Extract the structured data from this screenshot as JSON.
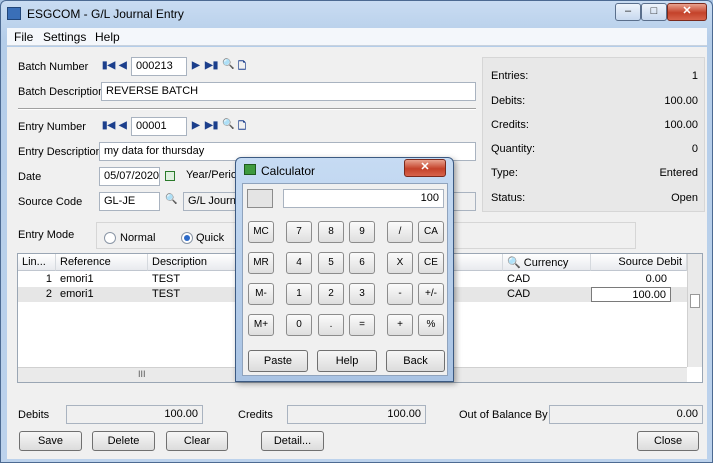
{
  "window": {
    "title": "ESGCOM - G/L Journal Entry",
    "controls": {
      "minimize": "–",
      "maximize": "□",
      "close": "✕"
    }
  },
  "menu": {
    "file": "File",
    "settings": "Settings",
    "help": "Help"
  },
  "form": {
    "batch_number_label": "Batch Number",
    "batch_number": "000213",
    "batch_description_label": "Batch Description",
    "batch_description": "REVERSE BATCH",
    "entry_number_label": "Entry Number",
    "entry_number": "00001",
    "entry_description_label": "Entry Description",
    "entry_description": "my data for thursday",
    "date_label": "Date",
    "date": "05/07/2020",
    "year_period_label": "Year/Period",
    "source_code_label": "Source Code",
    "source_code": "GL-JE",
    "source_code_desc": "G/L Journal",
    "entry_mode_label": "Entry Mode",
    "mode_normal": "Normal",
    "mode_quick": "Quick",
    "selected_mode": "Quick"
  },
  "summary": {
    "entries_label": "Entries:",
    "entries": "1",
    "debits_label": "Debits:",
    "debits": "100.00",
    "credits_label": "Credits:",
    "credits": "100.00",
    "quantity_label": "Quantity:",
    "quantity": "0",
    "type_label": "Type:",
    "type": "Entered",
    "status_label": "Status:",
    "status": "Open"
  },
  "grid": {
    "headers": {
      "line": "Lin...",
      "reference": "Reference",
      "description": "Description",
      "currency": "Currency",
      "source_debit": "Source Debit"
    },
    "rows": [
      {
        "line": "1",
        "reference": "emori1",
        "description": "TEST",
        "currency": "CAD",
        "source_debit": "0.00"
      },
      {
        "line": "2",
        "reference": "emori1",
        "description": "TEST",
        "currency": "CAD",
        "source_debit": "100.00"
      }
    ],
    "scroll_thumb": "III"
  },
  "totals": {
    "debits_label": "Debits",
    "debits": "100.00",
    "credits_label": "Credits",
    "credits": "100.00",
    "out_of_balance_label": "Out of Balance By",
    "out_of_balance": "0.00"
  },
  "buttons": {
    "save": "Save",
    "delete": "Delete",
    "clear": "Clear",
    "detail": "Detail...",
    "close": "Close"
  },
  "calculator": {
    "title": "Calculator",
    "display": "100",
    "rows": [
      [
        "MC",
        "7",
        "8",
        "9",
        "/",
        "CA"
      ],
      [
        "MR",
        "4",
        "5",
        "6",
        "X",
        "CE"
      ],
      [
        "M-",
        "1",
        "2",
        "3",
        "-",
        "+/-"
      ],
      [
        "M+",
        "0",
        ".",
        "=",
        "+",
        "%"
      ]
    ],
    "paste": "Paste",
    "help": "Help",
    "back": "Back",
    "close": "✕"
  }
}
